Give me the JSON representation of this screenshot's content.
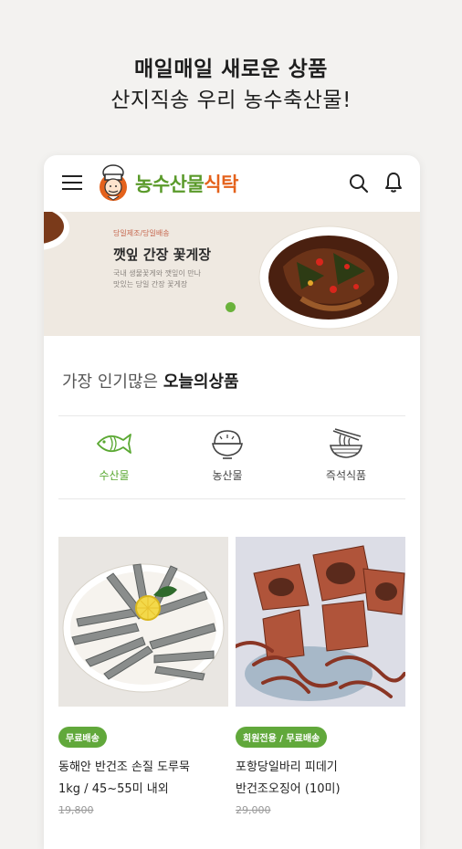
{
  "promo": {
    "title": "매일매일 새로운 상품",
    "subtitle": "산지직송 우리 농수축산물!"
  },
  "header": {
    "logo_part1": "농수산물",
    "logo_part2": "식탁",
    "brand_green": "#5a9a2a",
    "brand_orange": "#e4621c"
  },
  "banner": {
    "tag": "당일제조/당일배송",
    "title": "깻잎 간장 꽃게장",
    "desc_line1": "국내 생물꽃게와 깻잎이 만나",
    "desc_line2": "맛있는 당일 간장 꽃게장",
    "active_dot_color": "#6ab23b"
  },
  "section": {
    "title_prefix": "가장 인기많은 ",
    "title_bold": "오늘의상품"
  },
  "categories": [
    {
      "label": "수산물",
      "icon": "fish-icon",
      "active": true
    },
    {
      "label": "농산물",
      "icon": "rice-bowl-icon",
      "active": false
    },
    {
      "label": "즉석식품",
      "icon": "noodle-bowl-icon",
      "active": false
    }
  ],
  "products": [
    {
      "badge": "무료배송",
      "name_line1": "동해안 반건조 손질 도루묵",
      "name_line2": "1kg / 45~55미 내외",
      "price": "19,800"
    },
    {
      "badge": "회원전용 / 무료배송",
      "name_line1": "포항당일바리 피데기",
      "name_line2": "반건조오징어 (10미)",
      "price": "29,000"
    }
  ]
}
